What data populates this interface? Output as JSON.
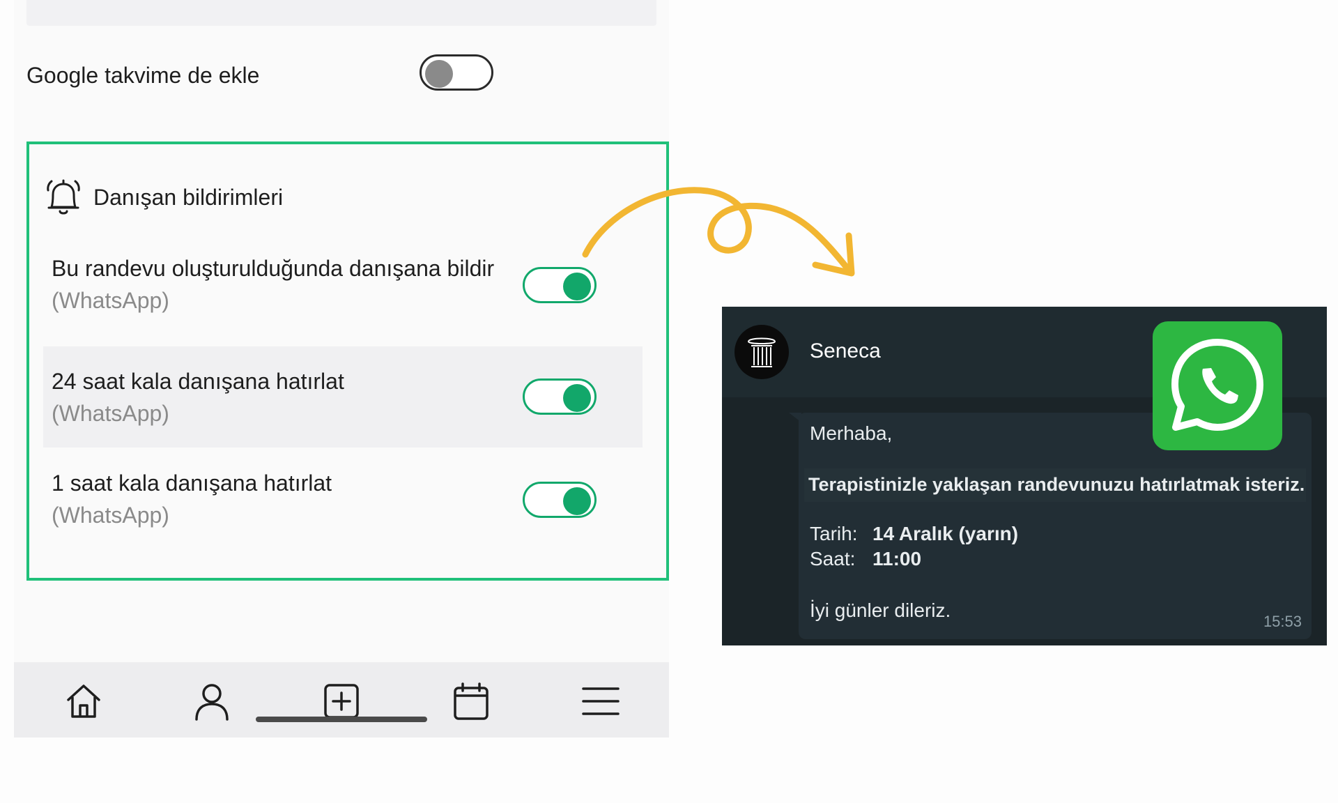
{
  "settings": {
    "google_calendar": {
      "label": "Google takvime de ekle",
      "enabled": false
    },
    "client_notifications": {
      "title": "Danışan bildirimleri",
      "options": [
        {
          "label": "Bu randevu oluşturulduğunda danışana bildir",
          "channel": "(WhatsApp)",
          "enabled": true
        },
        {
          "label": "24 saat kala danışana hatırlat",
          "channel": "(WhatsApp)",
          "enabled": true
        },
        {
          "label": "1 saat kala danışana hatırlat",
          "channel": "(WhatsApp)",
          "enabled": true
        }
      ]
    }
  },
  "bottom_nav": {
    "icons": [
      "home-icon",
      "user-icon",
      "add-icon",
      "calendar-icon",
      "menu-icon"
    ]
  },
  "whatsapp": {
    "contact_name": "Seneca",
    "message": {
      "greeting": "Merhaba,",
      "headline": "Terapistinizle yaklaşan randevunuzu hatırlatmak isteriz.",
      "date_label": "Tarih:",
      "date_value": "14 Aralık (yarın)",
      "time_label": "Saat:",
      "time_value": "11:00",
      "closing": "İyi günler dileriz.",
      "timestamp": "15:53"
    }
  },
  "colors": {
    "accent_green": "#20c07a",
    "toggle_on": "#12a76a",
    "whatsapp_green": "#2db742",
    "arrow_yellow": "#f2b632"
  }
}
